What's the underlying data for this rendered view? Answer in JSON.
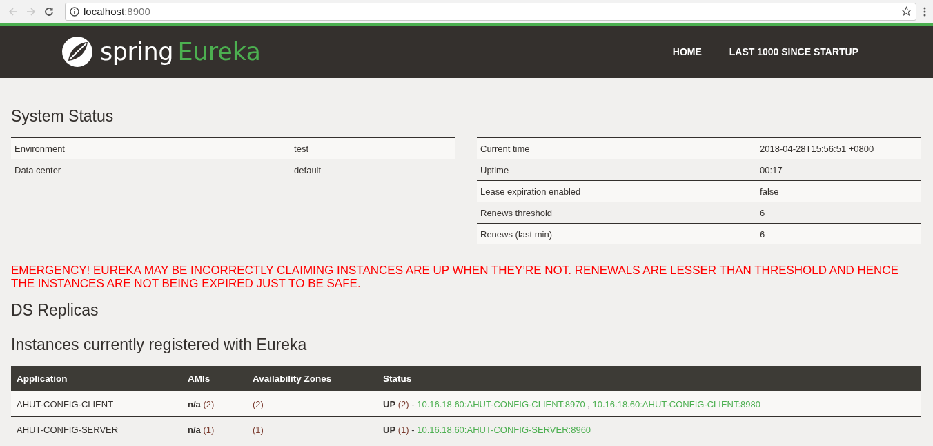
{
  "browser": {
    "url_host": "localhost",
    "url_port": ":8900"
  },
  "header": {
    "brand": "spring",
    "product": "Eureka",
    "nav": [
      {
        "label": "HOME"
      },
      {
        "label": "LAST 1000 SINCE STARTUP"
      }
    ]
  },
  "system_status": {
    "title": "System Status",
    "left_rows": [
      {
        "label": "Environment",
        "value": "test"
      },
      {
        "label": "Data center",
        "value": "default"
      }
    ],
    "right_rows": [
      {
        "label": "Current time",
        "value": "2018-04-28T15:56:51 +0800"
      },
      {
        "label": "Uptime",
        "value": "00:17"
      },
      {
        "label": "Lease expiration enabled",
        "value": "false"
      },
      {
        "label": "Renews threshold",
        "value": "6"
      },
      {
        "label": "Renews (last min)",
        "value": "6"
      }
    ]
  },
  "emergency": "EMERGENCY! EUREKA MAY BE INCORRECTLY CLAIMING INSTANCES ARE UP WHEN THEY’RE NOT. RENEWALS ARE LESSER THAN THRESHOLD AND HENCE THE INSTANCES ARE NOT BEING EXPIRED JUST TO BE SAFE.",
  "ds_replicas": {
    "title": "DS Replicas"
  },
  "instances": {
    "title": "Instances currently registered with Eureka",
    "columns": [
      "Application",
      "AMIs",
      "Availability Zones",
      "Status"
    ],
    "rows": [
      {
        "application": "AHUT-CONFIG-CLIENT",
        "amis": {
          "label": "n/a",
          "count": "(2)"
        },
        "zones": "(2)",
        "status": {
          "label": "UP",
          "count": "(2)",
          "dash": "-",
          "separator": ",",
          "links": [
            "10.16.18.60:AHUT-CONFIG-CLIENT:8970",
            "10.16.18.60:AHUT-CONFIG-CLIENT:8980"
          ]
        }
      },
      {
        "application": "AHUT-CONFIG-SERVER",
        "amis": {
          "label": "n/a",
          "count": "(1)"
        },
        "zones": "(1)",
        "status": {
          "label": "UP",
          "count": "(1)",
          "dash": "-",
          "links": [
            "10.16.18.60:AHUT-CONFIG-SERVER:8960"
          ]
        }
      }
    ]
  }
}
